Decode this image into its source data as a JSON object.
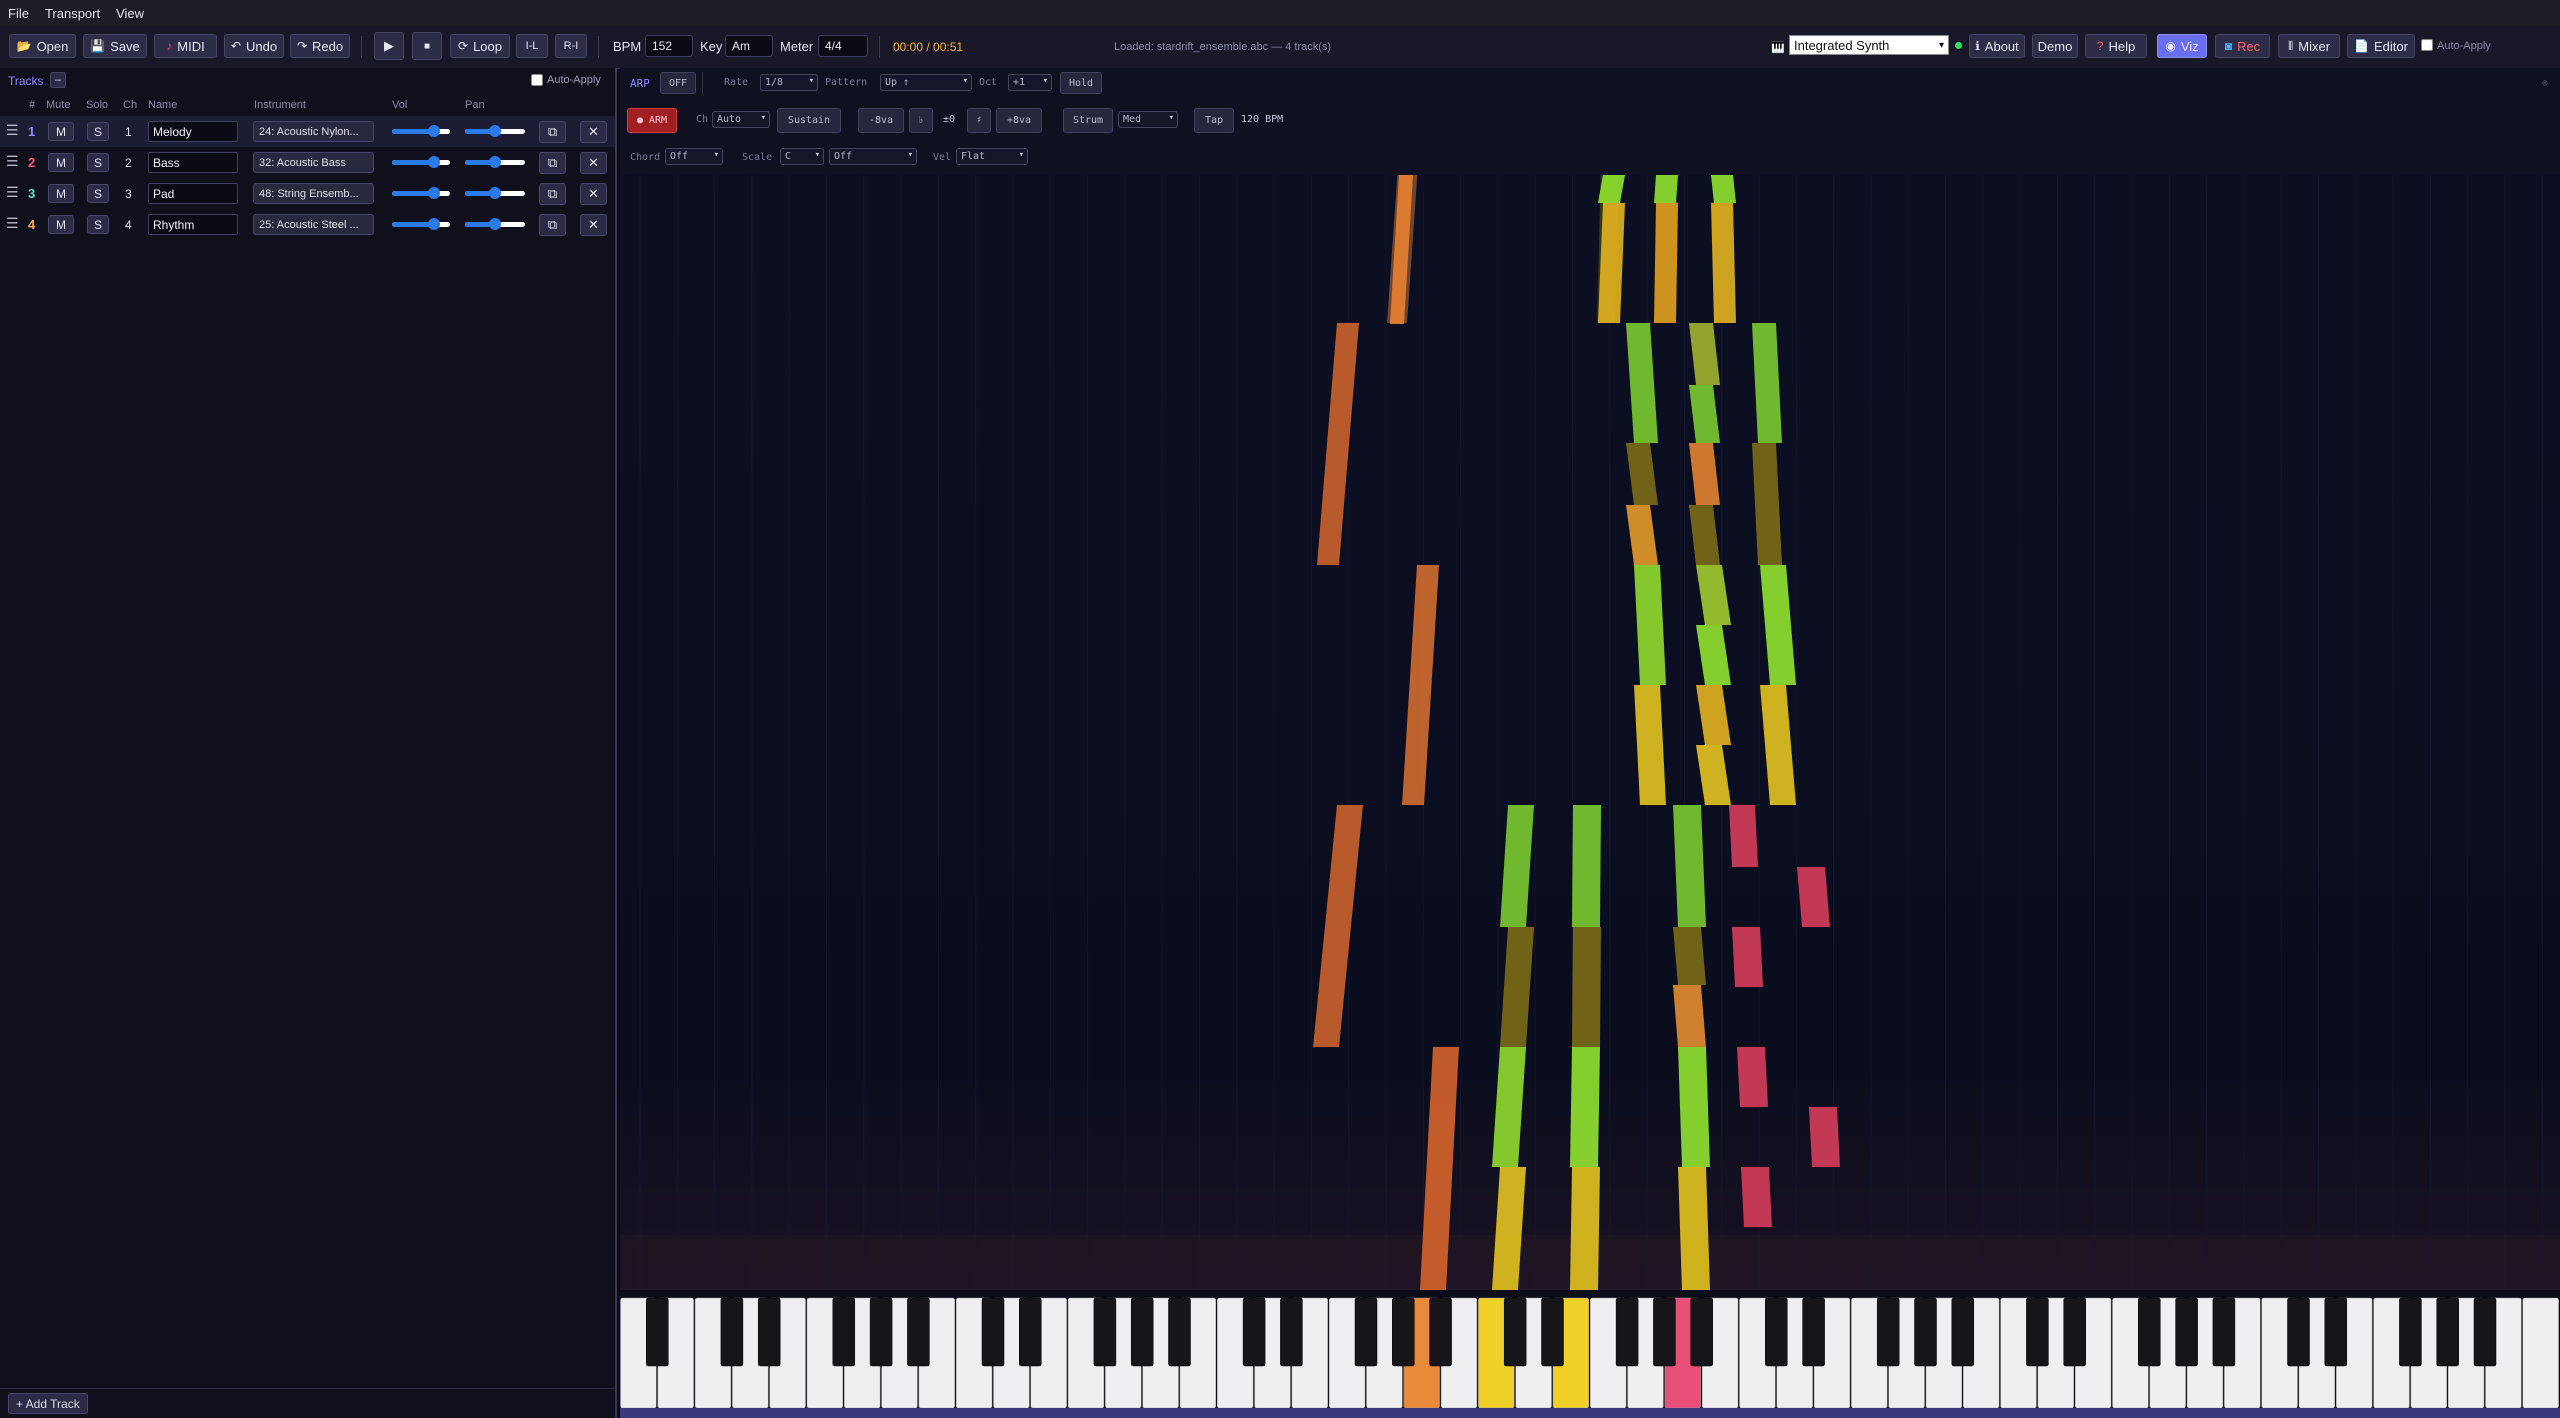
{
  "menu": [
    "File",
    "Transport",
    "View"
  ],
  "toolbar": {
    "open": "Open",
    "save": "Save",
    "midi": "MIDI",
    "undo": "Undo",
    "redo": "Redo",
    "play_icon": "▶",
    "stop_icon": "■",
    "loop": "Loop",
    "loop_left": "I-L",
    "loop_right": "R-I",
    "bpm_label": "BPM",
    "bpm_value": "152",
    "key_label": "Key",
    "key_value": "Am",
    "meter_label": "Meter",
    "meter_value": "4/4",
    "time": "00:00 / 00:51",
    "progress": 0,
    "status": "Loaded: stardrift_ensemble.abc — 4 track(s)",
    "synth_value": "Integrated Synth",
    "about": "About",
    "demo": "Demo",
    "help": "Help",
    "viz": "Viz",
    "rec": "Rec",
    "mixer": "Mixer",
    "editor": "Editor",
    "auto_apply": "Auto-Apply",
    "colors": {
      "viz": "#6a6ef0",
      "rec": "#ff5a6e",
      "help": "#ff5a5a",
      "time": "#ffb43c"
    }
  },
  "tracks_panel": {
    "title": "Tracks",
    "collapse": "–",
    "auto_apply": "Auto-Apply",
    "headers": {
      "num": "#",
      "mute": "Mute",
      "solo": "Solo",
      "ch": "Ch",
      "name": "Name",
      "instrument": "Instrument",
      "vol": "Vol",
      "pan": "Pan"
    },
    "rows": [
      {
        "num": "1",
        "ch": "1",
        "name": "Melody",
        "instrument": "24: Acoustic Nylon...",
        "vol": 0.72,
        "pan": 0.5,
        "color": "#8c8cff"
      },
      {
        "num": "2",
        "ch": "2",
        "name": "Bass",
        "instrument": "32: Acoustic Bass",
        "vol": 0.72,
        "pan": 0.5,
        "color": "#ff5a82"
      },
      {
        "num": "3",
        "ch": "3",
        "name": "Pad",
        "instrument": "48: String Ensemb...",
        "vol": 0.72,
        "pan": 0.5,
        "color": "#5ae6c8"
      },
      {
        "num": "4",
        "ch": "4",
        "name": "Rhythm",
        "instrument": "25: Acoustic Steel ...",
        "vol": 0.72,
        "pan": 0.5,
        "color": "#ffaa3c"
      }
    ],
    "mute_label": "M",
    "solo_label": "S",
    "add_track": "+ Add Track"
  },
  "arp": {
    "label": "ARP",
    "off": "OFF",
    "rate_label": "Rate",
    "rate_value": "1/8",
    "pattern_label": "Pattern",
    "pattern_value": "Up ↑",
    "oct_label": "Oct",
    "oct_value": "+1",
    "hold": "Hold",
    "arm": "● ARM",
    "ch_label": "Ch",
    "ch_value": "Auto",
    "sustain": "Sustain",
    "minus_8va": "-8va",
    "flat": "♭",
    "transpose": "±0",
    "sharp": "♯",
    "plus_8va": "+8va",
    "strum": "Strum",
    "strum_value": "Med",
    "tap": "Tap",
    "bpm_readout": "120 BPM",
    "chord_label": "Chord",
    "chord_value": "Off",
    "scale_label": "Scale",
    "scale_value": "C",
    "scale_mode": "Off",
    "vel_label": "Vel",
    "vel_value": "Flat"
  }
}
